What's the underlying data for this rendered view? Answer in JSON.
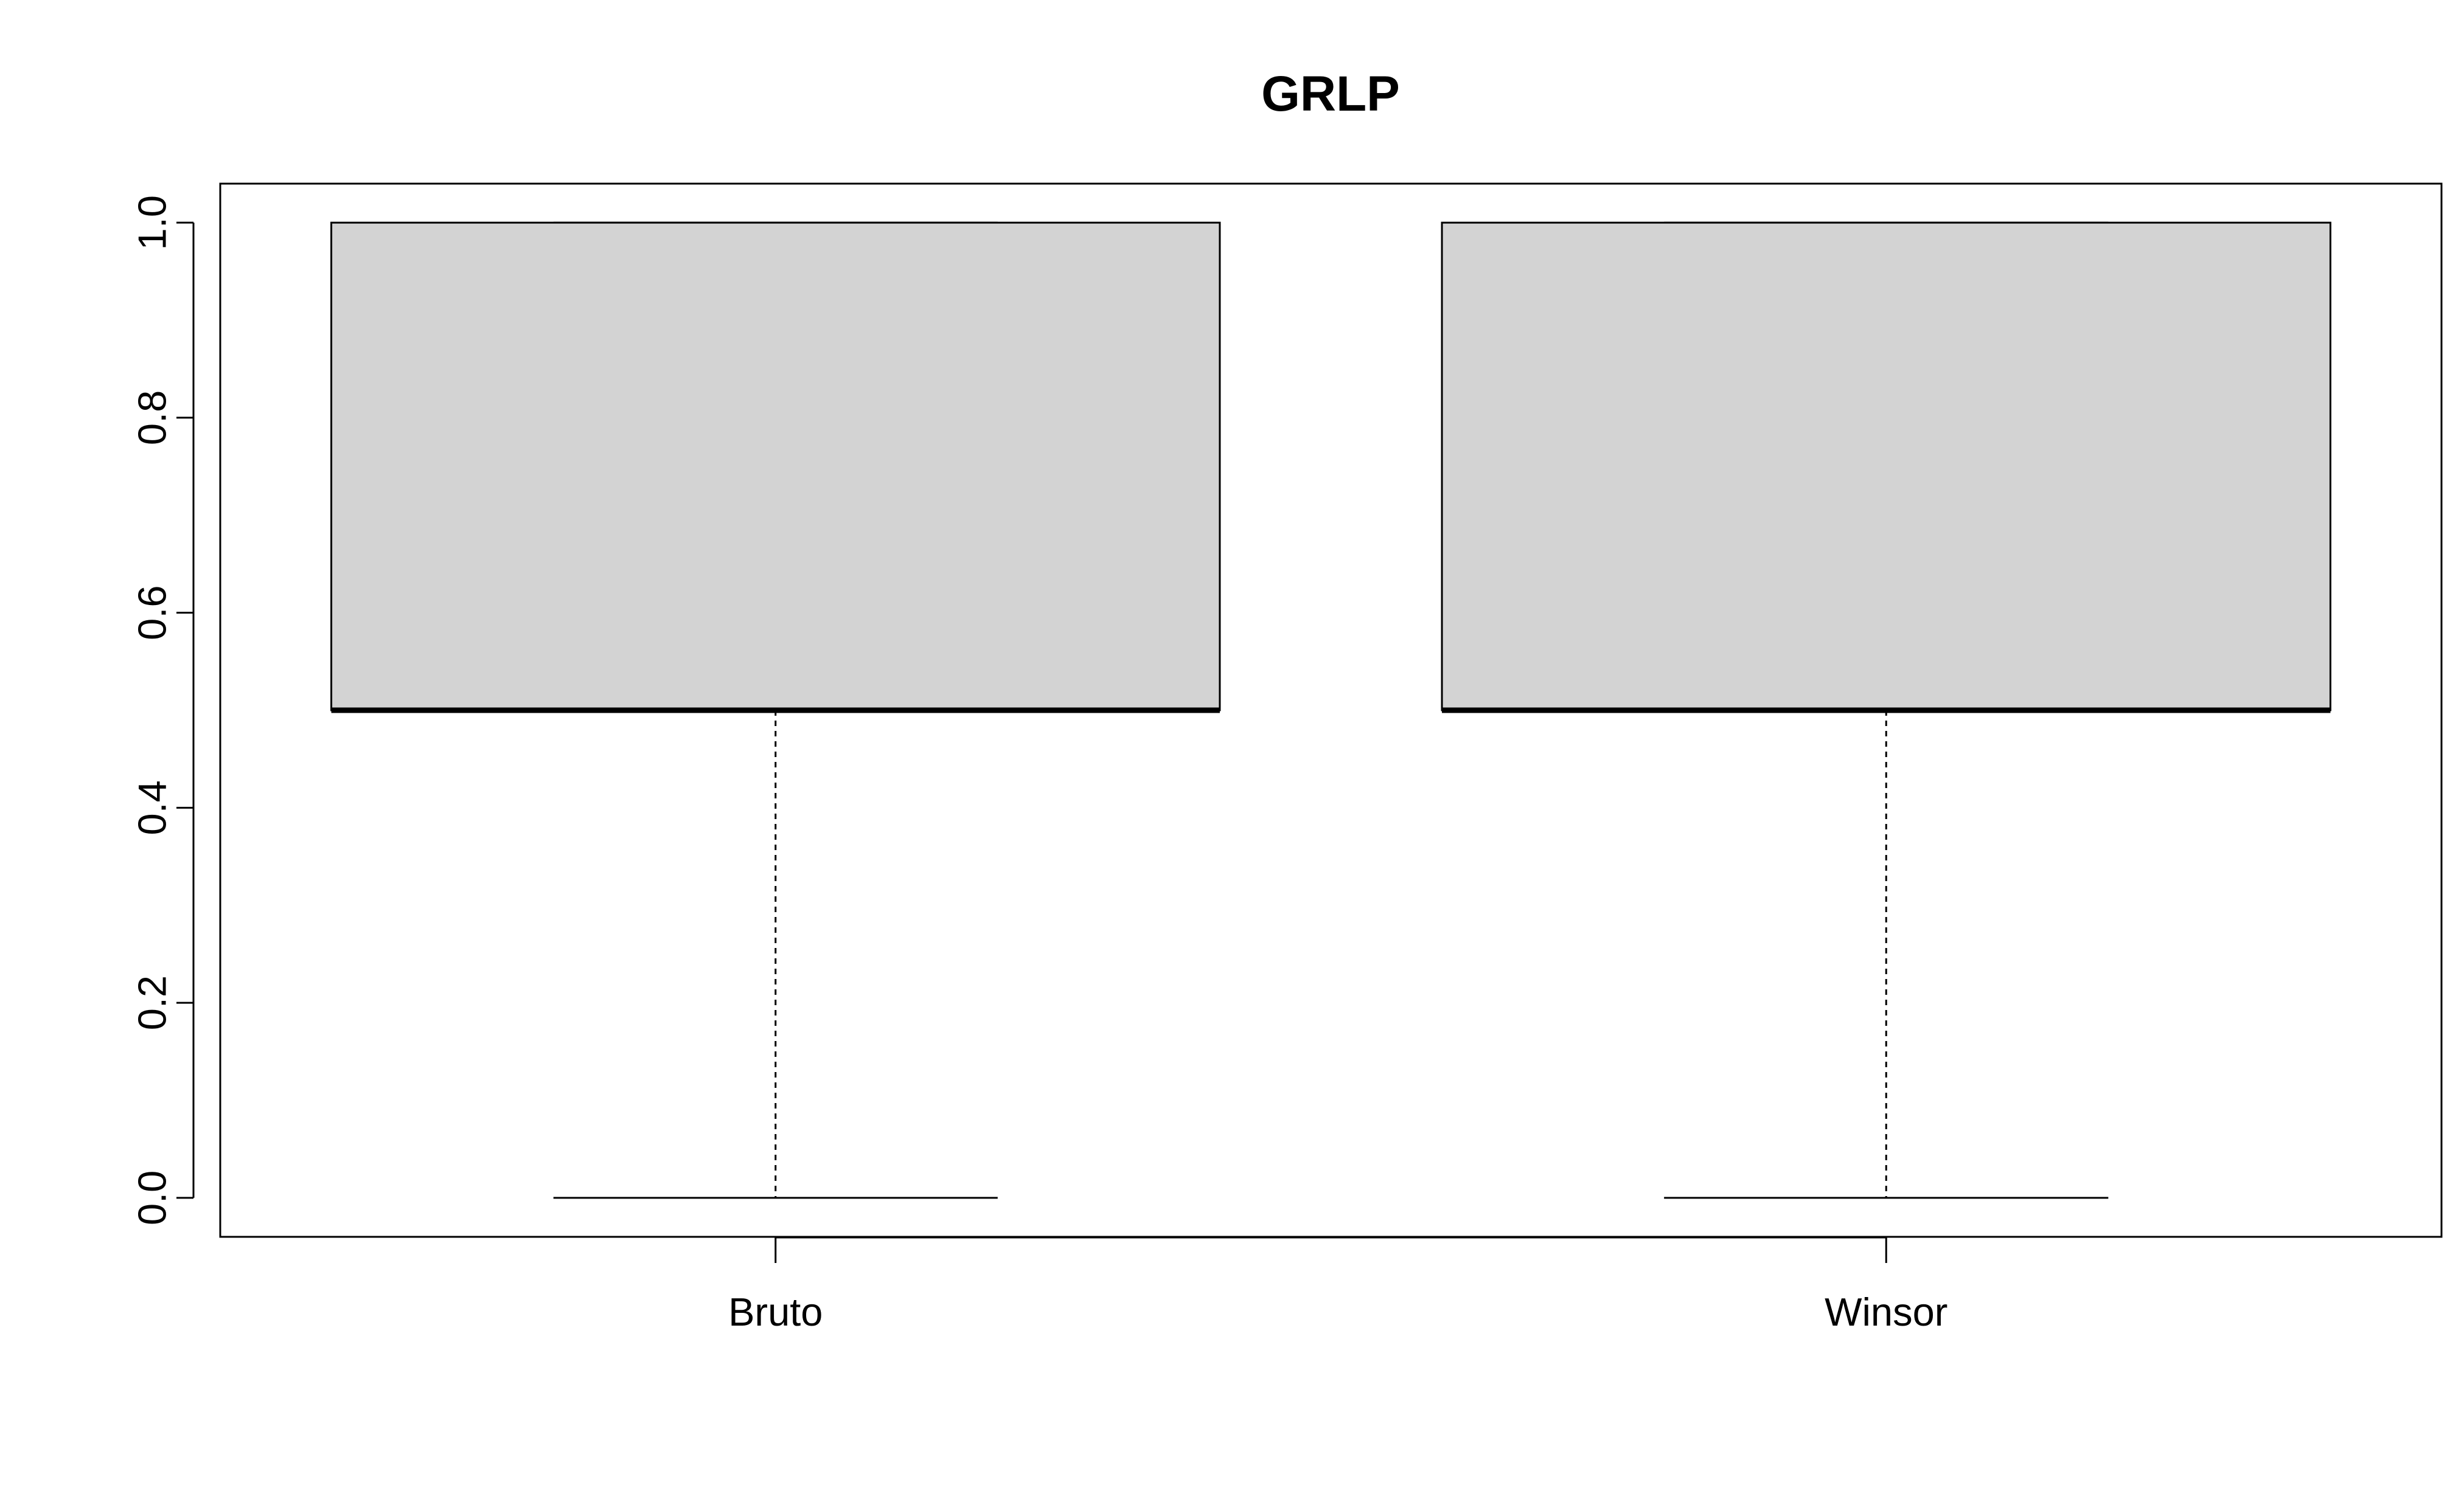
{
  "chart_data": {
    "type": "boxplot",
    "title": "GRLP",
    "xlabel": "",
    "ylabel": "",
    "categories": [
      "Bruto",
      "Winsor"
    ],
    "boxes": [
      {
        "label": "Bruto",
        "min": 0.0,
        "q1": 0.5,
        "median": 0.5,
        "q3": 1.0,
        "max": 1.0
      },
      {
        "label": "Winsor",
        "min": 0.0,
        "q1": 0.5,
        "median": 0.5,
        "q3": 1.0,
        "max": 1.0
      }
    ],
    "ylim": [
      -0.04,
      1.04
    ],
    "yticks": [
      "0.0",
      "0.2",
      "0.4",
      "0.6",
      "0.8",
      "1.0"
    ],
    "box_fill": "#d3d3d3",
    "grid": false
  }
}
